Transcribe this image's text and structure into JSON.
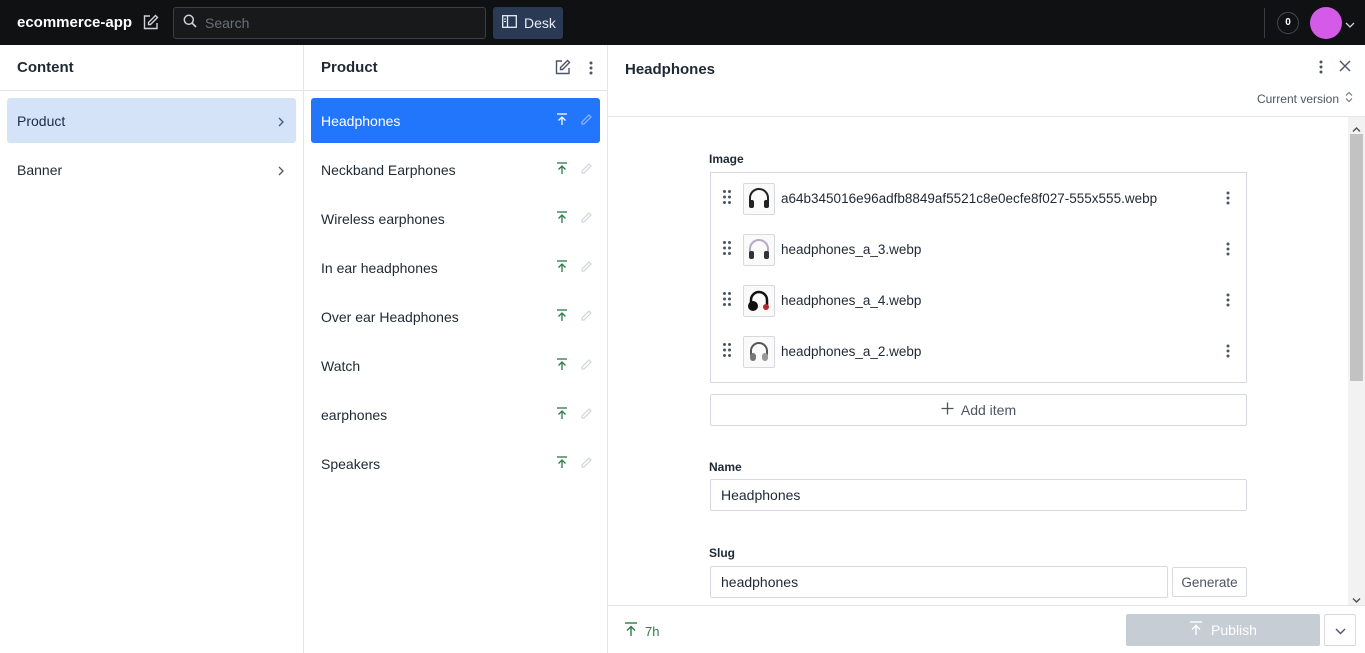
{
  "app": {
    "title": "ecommerce-app"
  },
  "topbar": {
    "search_placeholder": "Search",
    "desk_label": "Desk",
    "notification_count": "0",
    "avatar_color": "#d45ae8"
  },
  "content_pane": {
    "title": "Content",
    "items": [
      {
        "label": "Product",
        "selected": true
      },
      {
        "label": "Banner",
        "selected": false
      }
    ]
  },
  "product_pane": {
    "title": "Product",
    "items": [
      {
        "label": "Headphones",
        "selected": true
      },
      {
        "label": "Neckband Earphones"
      },
      {
        "label": "Wireless earphones"
      },
      {
        "label": "In ear headphones"
      },
      {
        "label": "Over ear Headphones"
      },
      {
        "label": "Watch"
      },
      {
        "label": "earphones"
      },
      {
        "label": "Speakers"
      }
    ]
  },
  "editor": {
    "title": "Headphones",
    "version_label": "Current version",
    "image_label": "Image",
    "images": [
      {
        "filename": "a64b345016e96adfb8849af5521c8e0ecfe8f027-555x555.webp"
      },
      {
        "filename": "headphones_a_3.webp"
      },
      {
        "filename": "headphones_a_4.webp"
      },
      {
        "filename": "headphones_a_2.webp"
      }
    ],
    "add_item_label": "Add item",
    "name_label": "Name",
    "name_value": "Headphones",
    "slug_label": "Slug",
    "slug_value": "headphones",
    "generate_label": "Generate"
  },
  "footer": {
    "status_time": "7h",
    "publish_label": "Publish"
  },
  "colors": {
    "accent_blue": "#2276fc",
    "published_green": "#2c7a45",
    "topbar_bg": "#101112"
  }
}
